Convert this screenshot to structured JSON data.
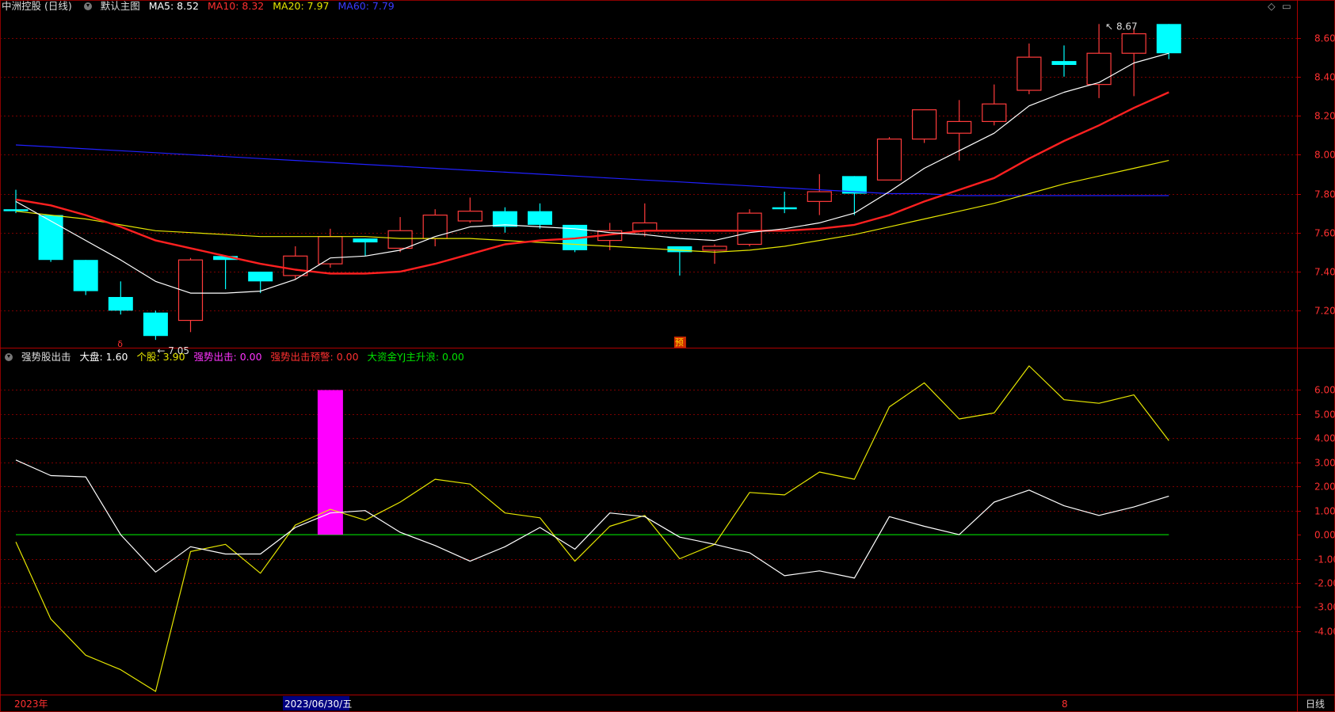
{
  "header": {
    "stock_name": "中洲控股 (日线)",
    "template_name": "默认主图",
    "ma5": "MA5: 8.52",
    "ma10": "MA10: 8.32",
    "ma20": "MA20: 7.97",
    "ma60": "MA60: 7.79"
  },
  "indicator_header": {
    "name": "强势股出击",
    "market": "大盘: 1.60",
    "stock": "个股: 3.90",
    "strong_attack": "强势出击: 0.00",
    "strong_attack_warn": "强势出击预警: 0.00",
    "big_money": "大资金YJ主升浪: 0.00"
  },
  "colors": {
    "up": "#ff3b3b",
    "down": "#00ffff",
    "ma5": "#ffffff",
    "ma10": "#ff2020",
    "ma20": "#e6e600",
    "ma60": "#2020ff",
    "bar_magenta": "#ff00ff",
    "zero_line": "#00c800",
    "grid": "#7a0000",
    "axis_text": "#ff3030"
  },
  "footer": {
    "year_label": "2023年",
    "date_label": "2023/06/30/五",
    "month_label": "8",
    "period_label": "日线"
  },
  "markers": {
    "high_label": "8.67",
    "low_label": "7.05",
    "signal_label": "预",
    "small_marker": "δ"
  },
  "chart_data": [
    {
      "type": "candlestick",
      "y_ticks": [
        "8.60",
        "8.40",
        "8.20",
        "8.00",
        "7.80",
        "7.60",
        "7.40",
        "7.20"
      ],
      "ylim": [
        7.01,
        8.72
      ],
      "candles": [
        {
          "o": 7.72,
          "h": 7.82,
          "l": 7.7,
          "c": 7.71
        },
        {
          "o": 7.69,
          "h": 7.69,
          "l": 7.45,
          "c": 7.46
        },
        {
          "o": 7.46,
          "h": 7.46,
          "l": 7.28,
          "c": 7.3
        },
        {
          "o": 7.27,
          "h": 7.35,
          "l": 7.18,
          "c": 7.2
        },
        {
          "o": 7.19,
          "h": 7.2,
          "l": 7.05,
          "c": 7.07
        },
        {
          "o": 7.15,
          "h": 7.47,
          "l": 7.09,
          "c": 7.46
        },
        {
          "o": 7.48,
          "h": 7.48,
          "l": 7.31,
          "c": 7.46
        },
        {
          "o": 7.4,
          "h": 7.4,
          "l": 7.29,
          "c": 7.35
        },
        {
          "o": 7.38,
          "h": 7.53,
          "l": 7.36,
          "c": 7.48
        },
        {
          "o": 7.44,
          "h": 7.62,
          "l": 7.42,
          "c": 7.58
        },
        {
          "o": 7.57,
          "h": 7.57,
          "l": 7.48,
          "c": 7.55
        },
        {
          "o": 7.52,
          "h": 7.68,
          "l": 7.5,
          "c": 7.61
        },
        {
          "o": 7.57,
          "h": 7.72,
          "l": 7.53,
          "c": 7.69
        },
        {
          "o": 7.66,
          "h": 7.78,
          "l": 7.65,
          "c": 7.71
        },
        {
          "o": 7.71,
          "h": 7.73,
          "l": 7.6,
          "c": 7.63
        },
        {
          "o": 7.71,
          "h": 7.75,
          "l": 7.62,
          "c": 7.64
        },
        {
          "o": 7.64,
          "h": 7.64,
          "l": 7.5,
          "c": 7.51
        },
        {
          "o": 7.56,
          "h": 7.65,
          "l": 7.51,
          "c": 7.61
        },
        {
          "o": 7.61,
          "h": 7.75,
          "l": 7.58,
          "c": 7.65
        },
        {
          "o": 7.53,
          "h": 7.53,
          "l": 7.38,
          "c": 7.5
        },
        {
          "o": 7.51,
          "h": 7.54,
          "l": 7.44,
          "c": 7.53
        },
        {
          "o": 7.54,
          "h": 7.72,
          "l": 7.53,
          "c": 7.7
        },
        {
          "o": 7.73,
          "h": 7.81,
          "l": 7.7,
          "c": 7.72
        },
        {
          "o": 7.76,
          "h": 7.9,
          "l": 7.69,
          "c": 7.81
        },
        {
          "o": 7.89,
          "h": 7.89,
          "l": 7.69,
          "c": 7.8
        },
        {
          "o": 7.87,
          "h": 8.09,
          "l": 7.87,
          "c": 8.08
        },
        {
          "o": 8.08,
          "h": 8.23,
          "l": 8.06,
          "c": 8.23
        },
        {
          "o": 8.11,
          "h": 8.28,
          "l": 7.97,
          "c": 8.17
        },
        {
          "o": 8.17,
          "h": 8.36,
          "l": 8.15,
          "c": 8.26
        },
        {
          "o": 8.33,
          "h": 8.57,
          "l": 8.31,
          "c": 8.5
        },
        {
          "o": 8.48,
          "h": 8.56,
          "l": 8.4,
          "c": 8.46
        },
        {
          "o": 8.36,
          "h": 8.67,
          "l": 8.29,
          "c": 8.52
        },
        {
          "o": 8.52,
          "h": 8.65,
          "l": 8.3,
          "c": 8.62
        },
        {
          "o": 8.67,
          "h": 8.67,
          "l": 8.49,
          "c": 8.52
        }
      ],
      "ma5": [
        7.76,
        7.66,
        7.56,
        7.46,
        7.35,
        7.29,
        7.29,
        7.3,
        7.36,
        7.47,
        7.48,
        7.51,
        7.58,
        7.63,
        7.64,
        7.63,
        7.62,
        7.6,
        7.59,
        7.57,
        7.56,
        7.6,
        7.62,
        7.65,
        7.7,
        7.81,
        7.93,
        8.02,
        8.11,
        8.25,
        8.32,
        8.37,
        8.47,
        8.52
      ],
      "ma10": [
        7.77,
        7.74,
        7.69,
        7.63,
        7.56,
        7.52,
        7.48,
        7.44,
        7.41,
        7.39,
        7.39,
        7.4,
        7.44,
        7.49,
        7.54,
        7.56,
        7.57,
        7.59,
        7.61,
        7.61,
        7.61,
        7.61,
        7.61,
        7.62,
        7.64,
        7.69,
        7.76,
        7.82,
        7.88,
        7.98,
        8.07,
        8.15,
        8.24,
        8.32
      ],
      "ma20": [
        7.71,
        7.69,
        7.67,
        7.64,
        7.61,
        7.6,
        7.59,
        7.58,
        7.58,
        7.58,
        7.58,
        7.57,
        7.57,
        7.57,
        7.56,
        7.55,
        7.54,
        7.53,
        7.52,
        7.51,
        7.5,
        7.51,
        7.53,
        7.56,
        7.59,
        7.63,
        7.67,
        7.71,
        7.75,
        7.8,
        7.85,
        7.89,
        7.93,
        7.97
      ],
      "ma60": [
        8.05,
        8.04,
        8.03,
        8.02,
        8.01,
        8.0,
        7.99,
        7.98,
        7.97,
        7.96,
        7.95,
        7.94,
        7.93,
        7.92,
        7.91,
        7.9,
        7.89,
        7.88,
        7.87,
        7.86,
        7.85,
        7.84,
        7.83,
        7.82,
        7.81,
        7.8,
        7.8,
        7.79,
        7.79,
        7.79,
        7.79,
        7.79,
        7.79,
        7.79
      ]
    },
    {
      "type": "line",
      "y_ticks": [
        "6.00",
        "5.00",
        "4.00",
        "3.00",
        "2.00",
        "1.00",
        "0.00",
        "-1.00",
        "-2.00",
        "-3.00",
        "-4.00"
      ],
      "ylim": [
        -6.6,
        7.1
      ],
      "series": [
        {
          "name": "大盘",
          "values": [
            3.1,
            2.45,
            2.4,
            0.0,
            -1.55,
            -0.5,
            -0.8,
            -0.8,
            0.3,
            0.9,
            1.0,
            0.1,
            -0.45,
            -1.1,
            -0.5,
            0.3,
            -0.6,
            0.9,
            0.75,
            -0.1,
            -0.4,
            -0.75,
            -1.7,
            -1.5,
            -1.8,
            0.75,
            0.35,
            0.0,
            1.35,
            1.85,
            1.2,
            0.8,
            1.15,
            1.6
          ]
        },
        {
          "name": "个股",
          "values": [
            -0.3,
            -3.5,
            -5.0,
            -5.6,
            -6.5,
            -0.7,
            -0.4,
            -1.6,
            0.4,
            1.05,
            0.6,
            1.35,
            2.3,
            2.1,
            0.9,
            0.7,
            -1.1,
            0.35,
            0.8,
            -1.0,
            -0.4,
            1.75,
            1.65,
            2.6,
            2.3,
            5.3,
            6.3,
            4.8,
            5.05,
            7.0,
            5.6,
            5.45,
            5.8,
            3.9
          ]
        }
      ],
      "bars": [
        {
          "index": 9,
          "value": 6.0
        }
      ],
      "zero_line": 0
    }
  ]
}
